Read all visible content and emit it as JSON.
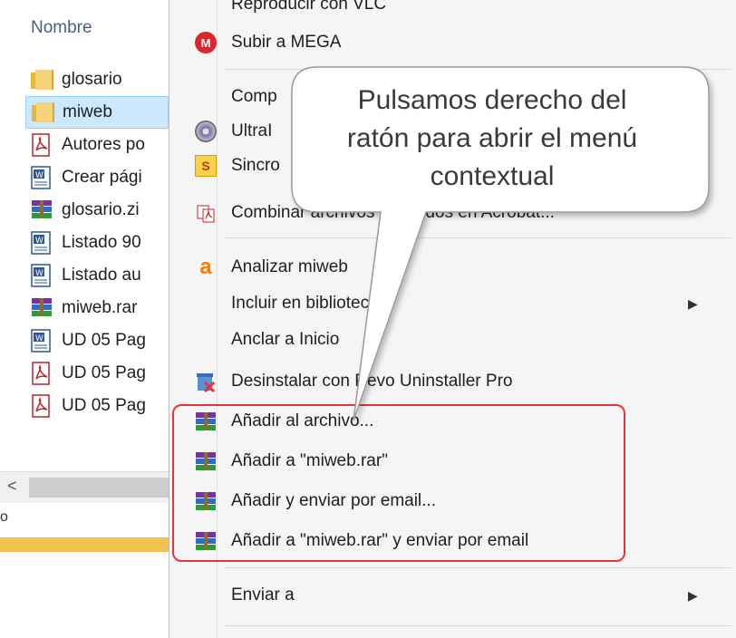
{
  "explorer": {
    "column_header": "Nombre",
    "files": [
      {
        "name": "glosario",
        "icon": "folder-icon",
        "selected": false
      },
      {
        "name": "miweb",
        "icon": "folder-icon",
        "selected": true
      },
      {
        "name": "Autores po",
        "icon": "pdf-icon",
        "selected": false
      },
      {
        "name": "Crear pági",
        "icon": "doc-icon",
        "selected": false
      },
      {
        "name": "glosario.zi",
        "icon": "rar-icon",
        "selected": false
      },
      {
        "name": "Listado 90",
        "icon": "doc-icon",
        "selected": false
      },
      {
        "name": "Listado au",
        "icon": "doc-icon",
        "selected": false
      },
      {
        "name": "miweb.rar",
        "icon": "rar-icon",
        "selected": false
      },
      {
        "name": "UD 05 Pag",
        "icon": "doc-icon",
        "selected": false
      },
      {
        "name": "UD 05 Pag",
        "icon": "pdf-icon",
        "selected": false
      },
      {
        "name": "UD 05 Pag",
        "icon": "pdf-icon",
        "selected": false
      }
    ],
    "scroll_left_glyph": "<",
    "status_glyph": "o"
  },
  "menu": {
    "items": [
      {
        "label": "Reproducir con VLC",
        "icon": "",
        "submenu": false
      },
      {
        "label": "Subir a MEGA",
        "icon": "mega-icon",
        "submenu": false
      },
      {
        "label": "Comp",
        "icon": "",
        "submenu": false
      },
      {
        "label": "UltraI",
        "icon": "disc-icon",
        "submenu": false
      },
      {
        "label": "Sincro",
        "icon": "sync-icon",
        "submenu": false
      },
      {
        "label": "Combinar archivos admitidos en Acrobat...",
        "icon": "acrobat-icon",
        "submenu": false
      },
      {
        "label": "Analizar miweb",
        "icon": "avast-icon",
        "submenu": false
      },
      {
        "label": "Incluir en biblioteca",
        "icon": "",
        "submenu": true
      },
      {
        "label": "Anclar a Inicio",
        "icon": "",
        "submenu": false
      },
      {
        "label": "Desinstalar con Revo Uninstaller Pro",
        "icon": "revo-icon",
        "submenu": false
      },
      {
        "label": "Añadir al archivo...",
        "icon": "winrar-icon",
        "submenu": false
      },
      {
        "label": "Añadir a \"miweb.rar\"",
        "icon": "winrar-icon",
        "submenu": false
      },
      {
        "label": "Añadir y enviar por email...",
        "icon": "winrar-icon",
        "submenu": false
      },
      {
        "label": "Añadir a \"miweb.rar\" y enviar por email",
        "icon": "winrar-icon",
        "submenu": false
      },
      {
        "label": "Enviar a",
        "icon": "",
        "submenu": true
      }
    ],
    "submenu_glyph": "▶"
  },
  "callout": {
    "lines": [
      "Pulsamos derecho del",
      "ratón para abrir el menú",
      "contextual"
    ]
  },
  "colors": {
    "highlight_border": "#e8323c",
    "selection_bg": "#cce8ff",
    "menu_bg": "#f5f5f5"
  }
}
